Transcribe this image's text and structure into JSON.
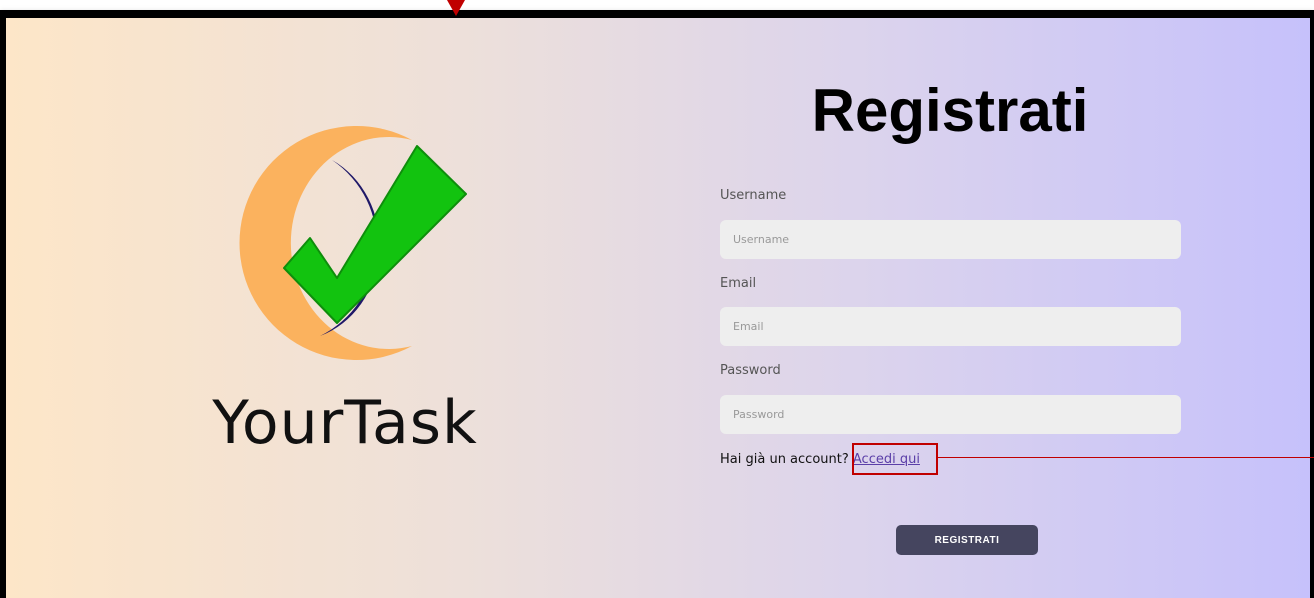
{
  "brand": {
    "name": "YourTask",
    "colors": {
      "ring_orange": "#fbb25e",
      "ring_navy": "#1f1868",
      "check_green": "#12c30f"
    }
  },
  "form": {
    "title": "Registrati",
    "fields": [
      {
        "label": "Username",
        "placeholder": "Username",
        "value": ""
      },
      {
        "label": "Email",
        "placeholder": "Email",
        "value": ""
      },
      {
        "label": "Password",
        "placeholder": "Password",
        "value": ""
      }
    ],
    "login_prompt": "Hai già un account?",
    "login_link": "Accedi qui",
    "submit_label": "REGISTRATI"
  },
  "colors": {
    "annotation": "#c00000",
    "button_bg": "#45455f",
    "link": "#5b3fa8"
  }
}
